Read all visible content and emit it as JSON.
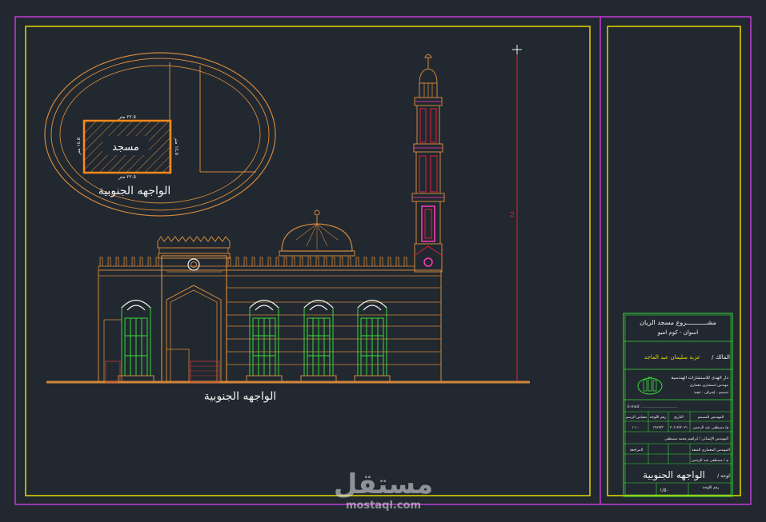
{
  "drawing": {
    "site_plan": {
      "building_label": "مسجد",
      "caption": "الواجهه الجنوبية",
      "dim_top": "٢٢.٥ متر",
      "dim_bottom": "٢٢.٥ متر",
      "dim_left": "١٤.٥ متر",
      "dim_right": "١٤.٥ متر"
    },
    "elevation": {
      "caption": "الواجهه الجنوبية",
      "height_dim": "٤٥"
    },
    "title_block": {
      "project_title": "مشـــــــــــروع مسجد الريان",
      "project_subtitle": "اسوان - كوم امبو",
      "owner_label": "المالك /",
      "owner_name": "عزبة سليمان عبد الماجد",
      "office_name": "دار الهدى للاستشارات الهندسية",
      "office_line2": "مهندس استشاري معماري",
      "office_line3": "تصميم - إشراف - تنفيذ",
      "office_email": "E-mail: ................................",
      "designer_label": "المهندس المصمم",
      "date_label": "التاريخ",
      "drawing_no_label": "رقم اللوحة",
      "scale_label": "مقياس الرسم",
      "date_value": "٢٠/١٢/٢٠٢١",
      "drawing_no_value": "١٣٨٩/٣",
      "scale_value": "١:١٠٠",
      "engineer_name": "م/ مصطفى عبد الرحمن",
      "engineer2": "المهندس الإنشائي / ابراهيم محمد مصطفى",
      "structural_label": "المهندس المعماري المنفذ",
      "exec_label": "م / مصطفى عبد الرحمن",
      "revision_label": "المراجعة",
      "sheet_title": "الواجهه الجنوبية",
      "sheet_prefix": "لوحة /",
      "sheet_scale": "١/٥٠",
      "sheet_no_label": "رقم اللوحة"
    }
  },
  "watermark": {
    "brand": "مستقل",
    "url": "mostaql.com"
  },
  "colors": {
    "background": "#212830",
    "frame_magenta": "#c23ad6",
    "frame_yellow": "#e6d800",
    "cad_orange": "#d2873a",
    "cad_red": "#e0203a",
    "cad_pink": "#ff3ab5",
    "cad_green": "#3bd93b",
    "cad_white": "#f2f2f2"
  }
}
